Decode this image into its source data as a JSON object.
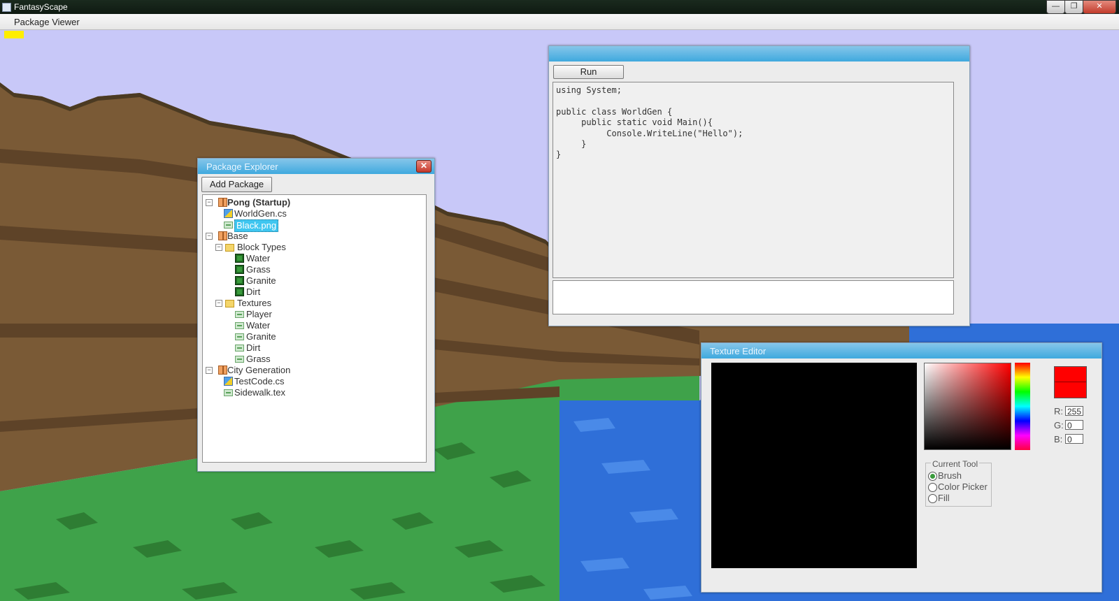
{
  "window": {
    "title": "FantasyScape",
    "minimize": "—",
    "maximize": "❐",
    "close": "✕"
  },
  "menu": {
    "items": [
      "Package Viewer"
    ]
  },
  "package_explorer": {
    "title": "Package Explorer",
    "close_glyph": "✕",
    "add_button": "Add Package",
    "tree": [
      {
        "label": "Pong (Startup)",
        "bold": true,
        "type": "package",
        "expander": "−"
      },
      {
        "label": "WorldGen.cs",
        "type": "code"
      },
      {
        "label": "Black.png",
        "type": "image",
        "selected": true
      },
      {
        "label": "Base",
        "type": "package",
        "expander": "−"
      },
      {
        "label": "Block Types",
        "type": "folder",
        "expander": "−"
      },
      {
        "label": "Water",
        "type": "block"
      },
      {
        "label": "Grass",
        "type": "block"
      },
      {
        "label": "Granite",
        "type": "block"
      },
      {
        "label": "Dirt",
        "type": "block"
      },
      {
        "label": "Textures",
        "type": "folder",
        "expander": "−"
      },
      {
        "label": "Player",
        "type": "image"
      },
      {
        "label": "Water",
        "type": "image"
      },
      {
        "label": "Granite",
        "type": "image"
      },
      {
        "label": "Dirt",
        "type": "image"
      },
      {
        "label": "Grass",
        "type": "image"
      },
      {
        "label": "City Generation",
        "type": "package",
        "expander": "−"
      },
      {
        "label": "TestCode.cs",
        "type": "code"
      },
      {
        "label": "Sidewalk.tex",
        "type": "image"
      }
    ]
  },
  "code_editor": {
    "run_button": "Run",
    "code_lines": [
      "using System;",
      "",
      "public class WorldGen {",
      "     public static void Main(){",
      "          Console.WriteLine(\"Hello\");",
      "     }",
      "}"
    ],
    "console_output": ""
  },
  "texture_editor": {
    "title": "Texture Editor",
    "color": {
      "r_label": "R:",
      "g_label": "G:",
      "b_label": "B:",
      "r": "255",
      "g": "0",
      "b": "0",
      "hex": "#ff0000"
    },
    "tool_group_label": "Current Tool",
    "tools": [
      "Brush",
      "Color Picker",
      "Fill"
    ],
    "selected_tool": "Brush"
  },
  "colors": {
    "accent": "#3fa9de",
    "selection": "#3fc6f0",
    "grass": "#3fa24a",
    "water": "#2f6fd8",
    "dirt": "#7a5a36",
    "sky": "#c8c8f8"
  }
}
